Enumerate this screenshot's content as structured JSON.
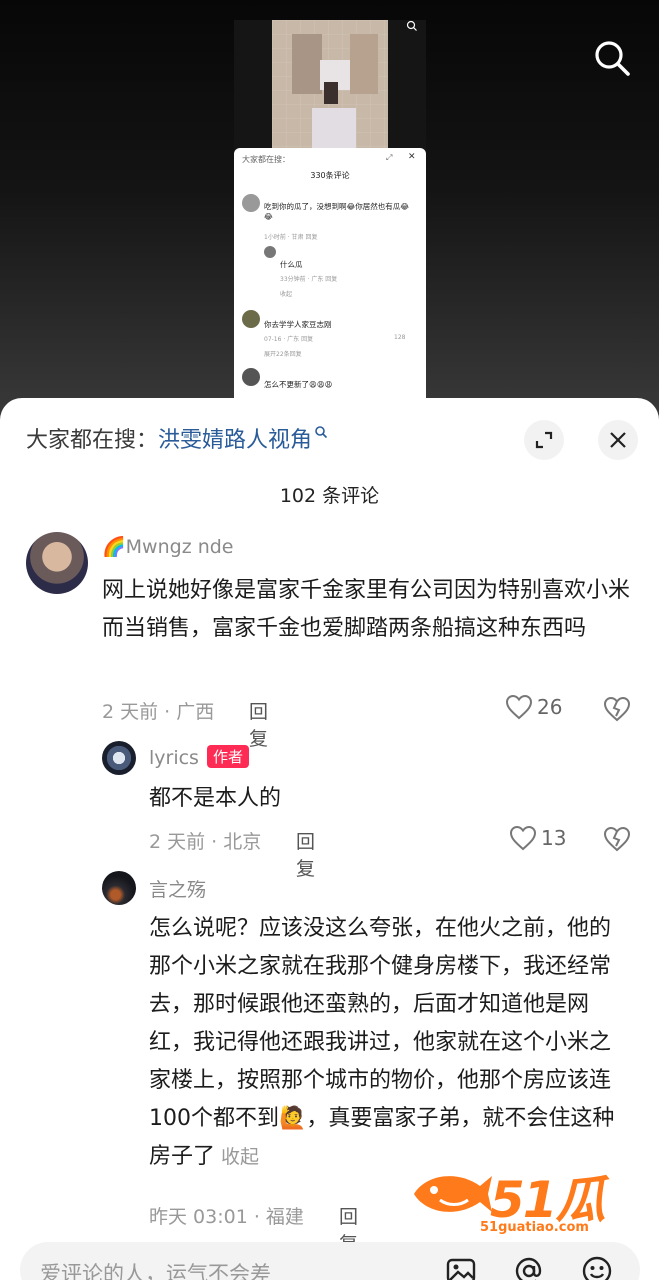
{
  "video": {
    "mini_panel": {
      "search_text": "大家都在搜：",
      "count": "330条评论",
      "comments": [
        {
          "text": "吃到你的瓜了，没想到啊😂你居然也有瓜😂😂",
          "meta": "1小时前 · 甘肃   回复"
        },
        {
          "text": "什么瓜",
          "meta": "33分钟前 · 广东   回复"
        },
        {
          "text": "收起"
        },
        {
          "text": "你去学学人家豆志刚",
          "meta": "07-16 · 广东   回复",
          "likes": "128"
        },
        {
          "text": "展开22条回复"
        },
        {
          "text": "怎么不更新了😩😩😩"
        }
      ]
    }
  },
  "sheet": {
    "hot_search_prefix": "大家都在搜：",
    "hot_search_keyword": "洪雯婧路人视角",
    "count": "102 条评论",
    "comments": [
      {
        "username": "🌈Mwngz nde",
        "text": "网上说她好像是富家千金家里有公司因为特别喜欢小米而当销售，富家千金也爱脚踏两条船搞这种东西吗",
        "meta": "2 天前 · 广西",
        "reply_label": "回复",
        "likes": "26"
      },
      {
        "username": "lyrics",
        "badge": "作者",
        "text": "都不是本人的",
        "meta": "2 天前 · 北京",
        "reply_label": "回复",
        "likes": "13"
      },
      {
        "username": "言之殇",
        "text": "怎么说呢？应该没这么夸张，在他火之前，他的那个小米之家就在我那个健身房楼下，我还经常去，那时候跟他还蛮熟的，后面才知道他是网红，我记得他还跟我讲过，他家就在这个小米之家楼上，按照那个城市的物价，他那个房应该连100个都不到🙋，真要富家子弟，就不会住这种房子了",
        "collapse": "收起",
        "meta": "昨天 03:01 · 福建",
        "reply_label": "回复"
      }
    ]
  },
  "watermark": {
    "text": "51瓜条",
    "url": "51guatiao.com"
  },
  "input_bar": {
    "placeholder": "爱评论的人，运气不会差"
  },
  "colors": {
    "keyword": "#2a5c9a",
    "author_badge": "#fe2c55",
    "watermark": "#ff7a1a"
  }
}
